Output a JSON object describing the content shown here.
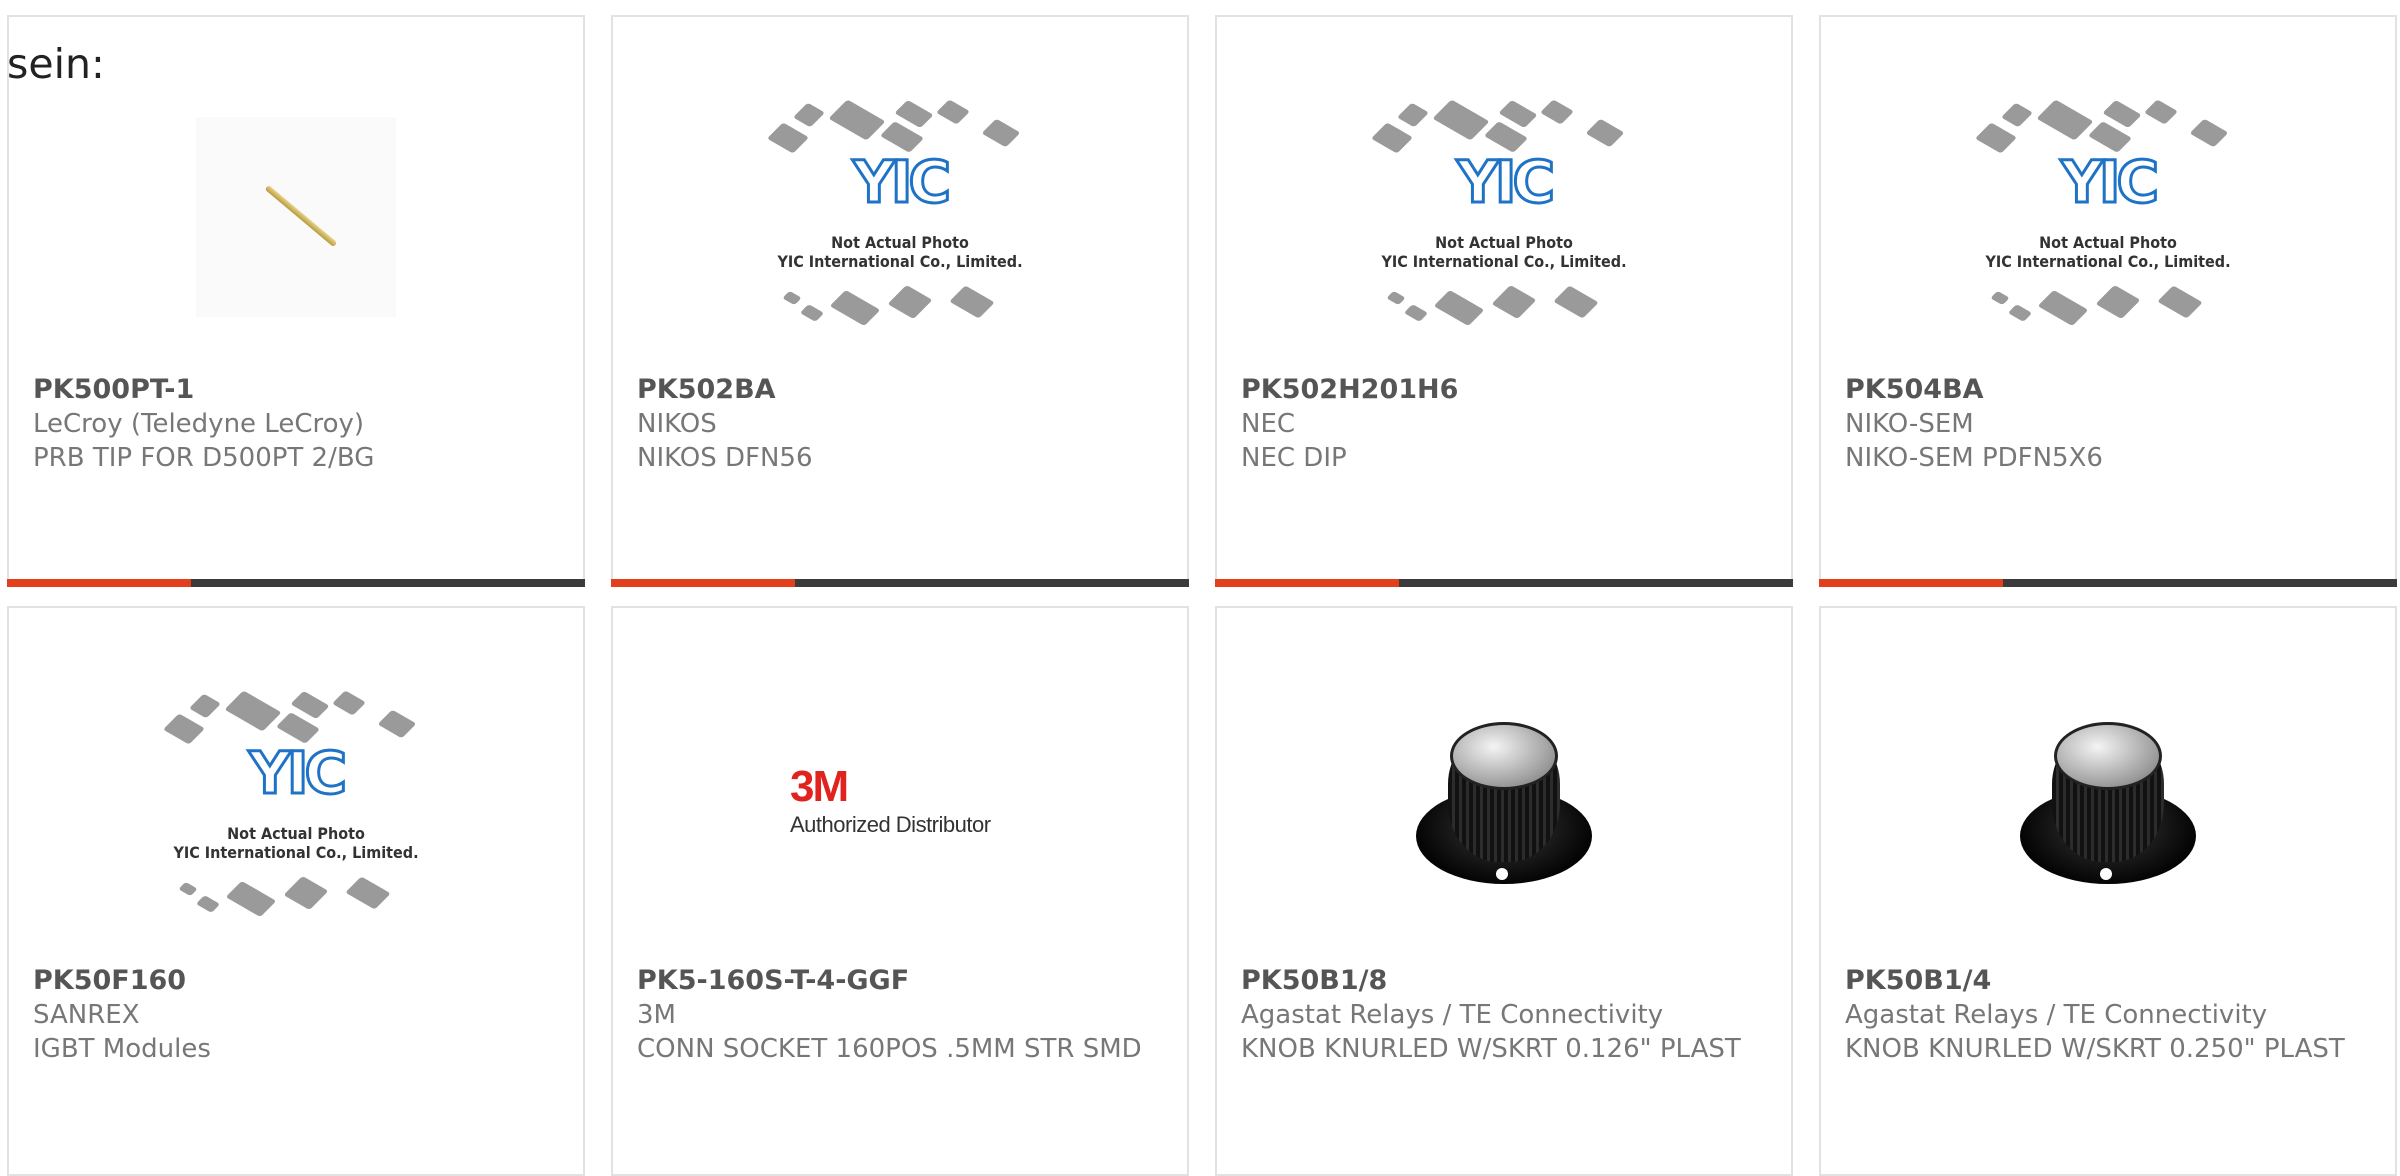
{
  "fragment_text": "sein:",
  "products": [
    {
      "part_number": "PK500PT-1",
      "manufacturer": "LeCroy (Teledyne LeCroy)",
      "description": "PRB TIP FOR D500PT 2/BG",
      "image": "probe-tip-photo"
    },
    {
      "part_number": "PK502BA",
      "manufacturer": "NIKOS",
      "description": "NIKOS DFN56",
      "image": "yic-placeholder"
    },
    {
      "part_number": "PK502H201H6",
      "manufacturer": "NEC",
      "description": "NEC DIP",
      "image": "yic-placeholder"
    },
    {
      "part_number": "PK504BA",
      "manufacturer": "NIKO-SEM",
      "description": "NIKO-SEM PDFN5X6",
      "image": "yic-placeholder"
    },
    {
      "part_number": "PK50F160",
      "manufacturer": "SANREX",
      "description": "IGBT Modules",
      "image": "yic-placeholder"
    },
    {
      "part_number": "PK5-160S-T-4-GGF",
      "manufacturer": "3M",
      "description": "CONN SOCKET 160POS .5MM STR SMD",
      "image": "3m-logo"
    },
    {
      "part_number": "PK50B1/8",
      "manufacturer": "Agastat Relays / TE Connectivity",
      "description": "KNOB KNURLED W/SKRT 0.126\" PLAST",
      "image": "knob-photo"
    },
    {
      "part_number": "PK50B1/4",
      "manufacturer": "Agastat Relays / TE Connectivity",
      "description": "KNOB KNURLED W/SKRT 0.250\" PLAST",
      "image": "knob-photo"
    }
  ],
  "placeholder": {
    "logo_text": "YIC",
    "line1": "Not Actual Photo",
    "line2": "YIC International Co., Limited."
  },
  "three_m": {
    "logo": "3M",
    "tagline": "Authorized Distributor"
  },
  "colors": {
    "accent": "#e2401c",
    "bar": "#3b3b3b",
    "logo_blue": "#1f73c6",
    "threem_red": "#e0231f"
  }
}
